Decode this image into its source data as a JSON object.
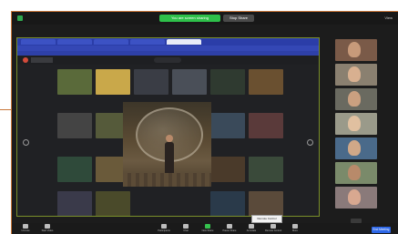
{
  "meeting": {
    "share_indicator": "You are screen sharing",
    "stop_share": "Stop Share",
    "view_label": "View"
  },
  "toolbar": {
    "items": [
      {
        "label": "Unmute",
        "icon": "mic-icon"
      },
      {
        "label": "Start Video",
        "icon": "video-icon"
      },
      {
        "label": "Participants",
        "icon": "participants-icon"
      },
      {
        "label": "Chat",
        "icon": "chat-icon"
      },
      {
        "label": "New Share",
        "icon": "share-screen-icon"
      },
      {
        "label": "Pause Share",
        "icon": "pause-icon"
      },
      {
        "label": "Annotate",
        "icon": "annotate-icon"
      },
      {
        "label": "Remote Control",
        "icon": "remote-control-icon"
      },
      {
        "label": "More",
        "icon": "more-icon"
      }
    ],
    "end_label": "End Meeting"
  },
  "tooltip": "Remote Control",
  "colors": {
    "share_green": "#2ec04a",
    "end_blue": "#2d67e8",
    "chrome_blue": "#2b3da8",
    "share_border": "#7a8f2a"
  }
}
